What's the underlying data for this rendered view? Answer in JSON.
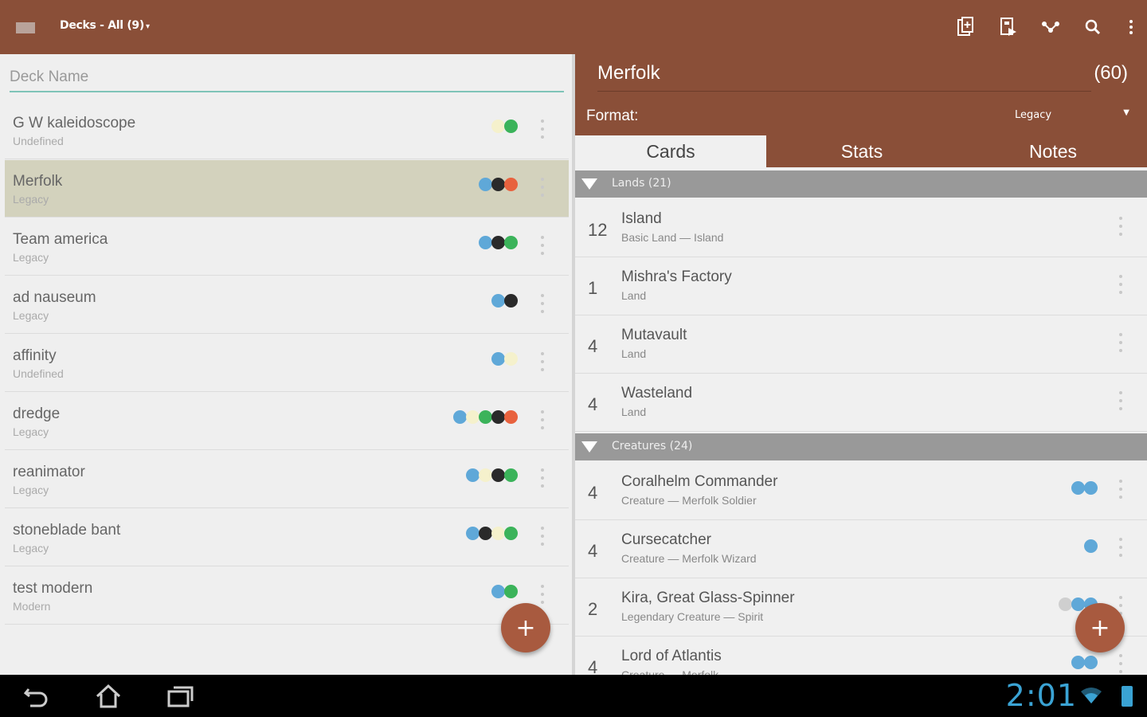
{
  "actionbar": {
    "title": "Decks - All (9)",
    "title_caret": "▾",
    "icons": [
      "new-deck-icon",
      "import-deck-icon",
      "share-icon",
      "search-icon",
      "overflow-menu-icon"
    ],
    "color": "#8a4f38"
  },
  "left": {
    "deck_name_placeholder": "Deck Name",
    "decks": [
      {
        "name": "G W kaleidoscope",
        "format": "Undefined",
        "colors": [
          "#f5f1cc",
          "#3bb35a"
        ],
        "selected": false
      },
      {
        "name": "Merfolk",
        "format": "Legacy",
        "colors": [
          "#5fa8d8",
          "#2a2a2a",
          "#e8623e"
        ],
        "selected": true
      },
      {
        "name": "Team america",
        "format": "Legacy",
        "colors": [
          "#5fa8d8",
          "#2a2a2a",
          "#3bb35a"
        ],
        "selected": false
      },
      {
        "name": "ad nauseum",
        "format": "Legacy",
        "colors": [
          "#5fa8d8",
          "#2a2a2a"
        ],
        "selected": false
      },
      {
        "name": "affinity",
        "format": "Undefined",
        "colors": [
          "#5fa8d8",
          "#f5f1cc"
        ],
        "selected": false
      },
      {
        "name": "dredge",
        "format": "Legacy",
        "colors": [
          "#5fa8d8",
          "#f5f1cc",
          "#3bb35a",
          "#2a2a2a",
          "#e8623e"
        ],
        "selected": false
      },
      {
        "name": "reanimator",
        "format": "Legacy",
        "colors": [
          "#5fa8d8",
          "#f5f1cc",
          "#2a2a2a",
          "#3bb35a"
        ],
        "selected": false
      },
      {
        "name": "stoneblade bant",
        "format": "Legacy",
        "colors": [
          "#5fa8d8",
          "#2a2a2a",
          "#f5f1cc",
          "#3bb35a"
        ],
        "selected": false
      },
      {
        "name": "test modern",
        "format": "Modern",
        "colors": [
          "#5fa8d8",
          "#3bb35a"
        ],
        "selected": false
      }
    ],
    "fab_label": "+"
  },
  "right": {
    "deck_title": "Merfolk",
    "deck_count": "(60)",
    "format_label": "Format:",
    "format_value": "Legacy",
    "tabs": [
      {
        "label": "Cards",
        "active": true
      },
      {
        "label": "Stats",
        "active": false
      },
      {
        "label": "Notes",
        "active": false
      }
    ],
    "sections": [
      {
        "title": "Lands (21)",
        "cards": [
          {
            "qty": "12",
            "name": "Island",
            "type": "Basic Land — Island",
            "colors": []
          },
          {
            "qty": "1",
            "name": "Mishra's Factory",
            "type": "Land",
            "colors": []
          },
          {
            "qty": "4",
            "name": "Mutavault",
            "type": "Land",
            "colors": []
          },
          {
            "qty": "4",
            "name": "Wasteland",
            "type": "Land",
            "colors": []
          }
        ]
      },
      {
        "title": "Creatures (24)",
        "cards": [
          {
            "qty": "4",
            "name": "Coralhelm Commander",
            "type": "Creature — Merfolk Soldier",
            "colors": [
              "#5fa8d8",
              "#5fa8d8"
            ]
          },
          {
            "qty": "4",
            "name": "Cursecatcher",
            "type": "Creature — Merfolk Wizard",
            "colors": [
              "#5fa8d8"
            ]
          },
          {
            "qty": "2",
            "name": "Kira, Great Glass-Spinner",
            "type": "Legendary Creature — Spirit",
            "colors": [
              "#cfcfcf",
              "#5fa8d8",
              "#5fa8d8"
            ]
          },
          {
            "qty": "4",
            "name": "Lord of Atlantis",
            "type": "Creature — Merfolk",
            "colors": [
              "#5fa8d8",
              "#5fa8d8"
            ]
          }
        ]
      }
    ],
    "fab_label": "+"
  },
  "navbar": {
    "icons": [
      "back-icon",
      "home-icon",
      "recent-apps-icon"
    ],
    "clock": "2:01",
    "accent": "#3aa3d4"
  }
}
